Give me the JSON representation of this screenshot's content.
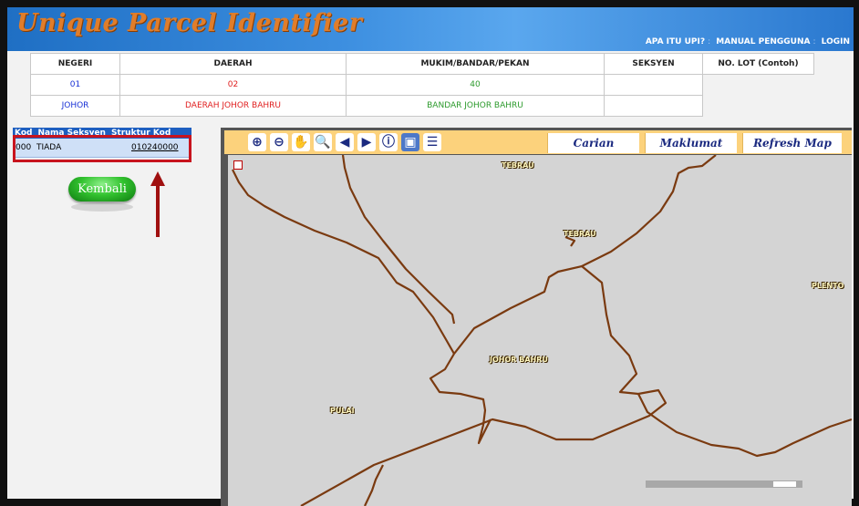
{
  "app": {
    "title": "Unique Parcel Identifier",
    "links": [
      "APA ITU UPI?",
      "MANUAL PENGGUNA",
      "LOGIN"
    ]
  },
  "info_table": {
    "headers": [
      "NEGERI",
      "DAERAH",
      "MUKIM/BANDAR/PEKAN",
      "SEKSYEN",
      "NO. LOT (Contoh)"
    ],
    "codes": [
      "01",
      "02",
      "40",
      "",
      ""
    ],
    "names": [
      "JOHOR",
      "DAERAH JOHOR BAHRU",
      "BANDAR JOHOR BAHRU",
      "",
      ""
    ]
  },
  "section_table": {
    "headers": [
      "Kod",
      "Nama Seksyen",
      "Struktur Kod"
    ],
    "rows": [
      {
        "kod": "000",
        "nama": "TIADA",
        "struktur": "010240000"
      }
    ]
  },
  "kembali_label": "Kembali",
  "toolbar": {
    "tools": [
      "zoom-in-icon",
      "zoom-out-icon",
      "pan-hand-icon",
      "zoom-box-icon",
      "zoom-previous-icon",
      "zoom-next-icon",
      "info-icon",
      "map-layer-icon",
      "legend-list-icon"
    ],
    "buttons": [
      "Carian",
      "Maklumat",
      "Refresh Map"
    ]
  },
  "map": {
    "labels": [
      "TEBRAU",
      "TEBRAU",
      "PLENTO",
      "JOHOR BAHRU",
      "PULAI"
    ]
  },
  "colors": {
    "header_blue": "#2a78cf",
    "title_orange": "#e07d2a",
    "toolbar_yellow": "#fcd27c",
    "road_brown": "#7a3a10",
    "highlight_red": "#c8141e"
  }
}
